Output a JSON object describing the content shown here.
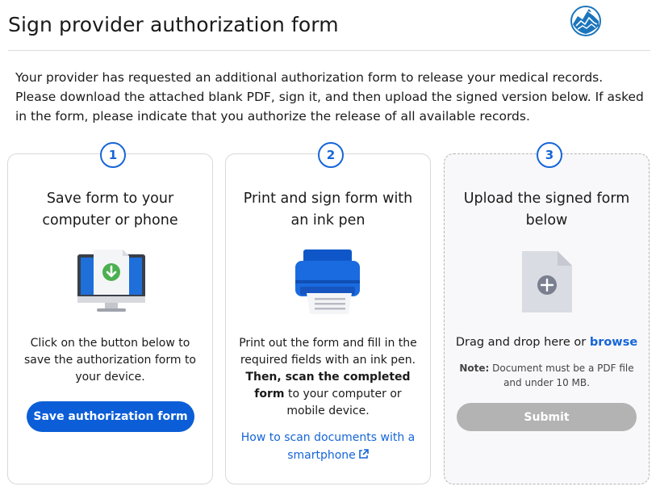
{
  "header": {
    "title": "Sign provider authorization form",
    "logo_icon": "rock-logo-icon"
  },
  "intro": {
    "text": "Your provider has requested an additional authorization form to release your medical records. Please download the attached blank PDF, sign it, and then upload the signed version below. If asked in the form, please indicate that you authorize the release of all available records."
  },
  "colors": {
    "accent": "#0b5ed7",
    "link": "#1565d8",
    "disabled": "#b3b3b3"
  },
  "steps": [
    {
      "number": "1",
      "title": "Save form to your computer or phone",
      "icon": "computer-download-icon",
      "body": "Click on the button below to save the authorization form to your device.",
      "button_label": "Save authorization form"
    },
    {
      "number": "2",
      "title": "Print and sign form with an ink pen",
      "icon": "printer-icon",
      "body_part1": "Print out the form and fill in the required fields with an ink pen.",
      "body_bold": "Then, scan the completed form",
      "body_part2": "to your computer or mobile device.",
      "link_text": "How to scan documents with a smartphone",
      "link_icon": "external-link-icon"
    },
    {
      "number": "3",
      "title": "Upload the signed form below",
      "icon": "file-add-icon",
      "drop_text": "Drag and drop here or",
      "browse_label": "browse",
      "note_label": "Note:",
      "note_text": "Document must be a PDF file and under 10 MB.",
      "submit_label": "Submit"
    }
  ]
}
